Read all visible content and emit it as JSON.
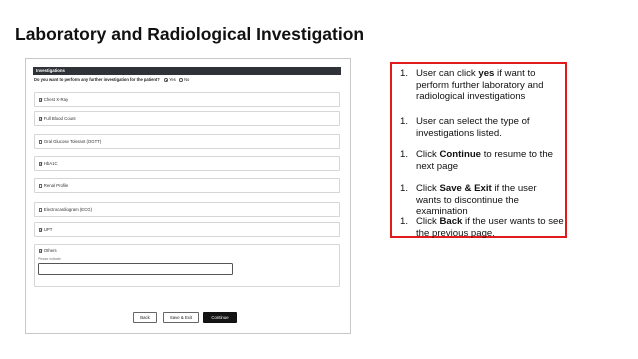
{
  "title": "Laboratory and Radiological Investigation",
  "form": {
    "section_header": "Investigations",
    "question": "Do you want to perform any further investigation for the patient?",
    "options": [
      {
        "label": "Yes",
        "selected": true
      },
      {
        "label": "No",
        "selected": false
      }
    ],
    "checkmark_glyph": "✔",
    "items": [
      {
        "label": "Chest X-Ray",
        "checked": true
      },
      {
        "label": "Full Blood Count",
        "checked": true
      },
      {
        "label": "Oral Glucose Tolerant (OGTT)",
        "checked": false
      },
      {
        "label": "HbA1C",
        "checked": true
      },
      {
        "label": "Renal Profile",
        "checked": false
      },
      {
        "label": "Electrocardiogram (ECG)",
        "checked": false
      },
      {
        "label": "UPT",
        "checked": true
      },
      {
        "label": "Others",
        "checked": true
      }
    ],
    "others_specify_label": "Please indicate",
    "others_specify_value": "",
    "buttons": {
      "back": "Back",
      "save_exit": "Save & Exit",
      "continue": "Continue"
    }
  },
  "instructions": [
    {
      "number": "1.",
      "parts": [
        "User can click ",
        "yes",
        " if want to perform further laboratory and radiological investigations"
      ]
    },
    {
      "number": "1.",
      "parts": [
        "User can select the type of investigations listed."
      ]
    },
    {
      "number": "1.",
      "parts": [
        "Click ",
        "Continue",
        " to resume to the next page"
      ]
    },
    {
      "number": "1.",
      "parts": [
        "Click ",
        "Save & Exit",
        " if the user wants to discontinue the examination"
      ]
    },
    {
      "number": "1.",
      "parts": [
        "Click ",
        "Back",
        " if the user wants to see the previous page."
      ]
    }
  ],
  "colors": {
    "accent_border": "#e11b1b",
    "header_bg": "#2f3337",
    "primary_button": "#141414"
  }
}
